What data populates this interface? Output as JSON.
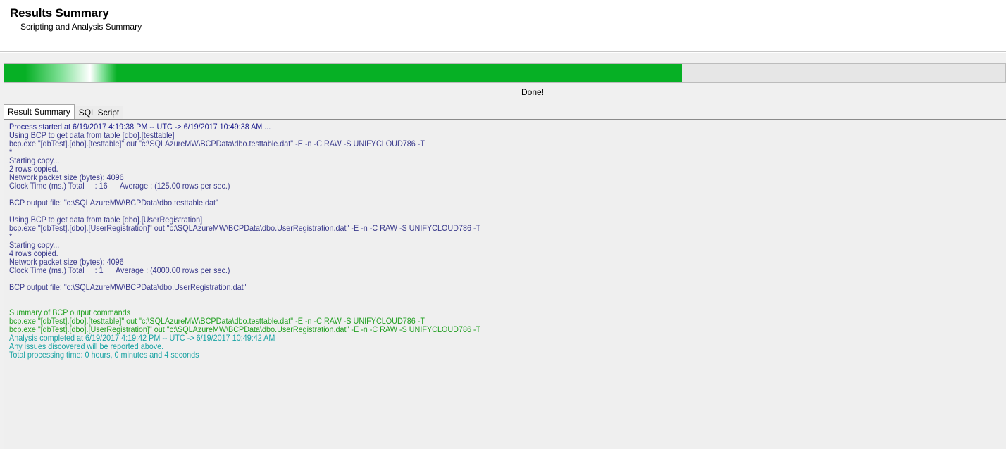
{
  "header": {
    "title": "Results Summary",
    "subtitle": "Scripting and Analysis Summary"
  },
  "progress": {
    "value_fraction": 0.677,
    "status": "Done!",
    "color": "#06b025"
  },
  "tabs": [
    {
      "label": "Result Summary",
      "active": true
    },
    {
      "label": "SQL Script",
      "active": false
    }
  ],
  "log": {
    "lines": [
      {
        "text": "Process started at 6/19/2017 4:19:38 PM -- UTC -> 6/19/2017 10:49:38 AM ...",
        "color": "navy"
      },
      {
        "text": "Using BCP to get data from table [dbo].[testtable]",
        "color": "blue"
      },
      {
        "text": "bcp.exe \"[dbTest].[dbo].[testtable]\" out \"c:\\SQLAzureMW\\BCPData\\dbo.testtable.dat\" -E -n -C RAW -S UNIFYCLOUD786 -T",
        "color": "blue"
      },
      {
        "text": "*",
        "color": "blue"
      },
      {
        "text": "Starting copy...",
        "color": "blue"
      },
      {
        "text": "2 rows copied.",
        "color": "blue"
      },
      {
        "text": "Network packet size (bytes): 4096",
        "color": "blue"
      },
      {
        "text": "Clock Time (ms.) Total     : 16      Average : (125.00 rows per sec.)",
        "color": "blue"
      },
      {
        "text": "",
        "color": "blue"
      },
      {
        "text": "BCP output file: \"c:\\SQLAzureMW\\BCPData\\dbo.testtable.dat\"",
        "color": "blue"
      },
      {
        "text": "",
        "color": "blue"
      },
      {
        "text": "Using BCP to get data from table [dbo].[UserRegistration]",
        "color": "blue"
      },
      {
        "text": "bcp.exe \"[dbTest].[dbo].[UserRegistration]\" out \"c:\\SQLAzureMW\\BCPData\\dbo.UserRegistration.dat\" -E -n -C RAW -S UNIFYCLOUD786 -T",
        "color": "blue"
      },
      {
        "text": "*",
        "color": "blue"
      },
      {
        "text": "Starting copy...",
        "color": "blue"
      },
      {
        "text": "4 rows copied.",
        "color": "blue"
      },
      {
        "text": "Network packet size (bytes): 4096",
        "color": "blue"
      },
      {
        "text": "Clock Time (ms.) Total     : 1      Average : (4000.00 rows per sec.)",
        "color": "blue"
      },
      {
        "text": "",
        "color": "blue"
      },
      {
        "text": "BCP output file: \"c:\\SQLAzureMW\\BCPData\\dbo.UserRegistration.dat\"",
        "color": "blue"
      },
      {
        "text": "",
        "color": "blue"
      },
      {
        "text": "",
        "color": "blue"
      },
      {
        "text": "Summary of BCP output commands",
        "color": "green"
      },
      {
        "text": "bcp.exe \"[dbTest].[dbo].[testtable]\" out \"c:\\SQLAzureMW\\BCPData\\dbo.testtable.dat\" -E -n -C RAW -S UNIFYCLOUD786 -T",
        "color": "green"
      },
      {
        "text": "bcp.exe \"[dbTest].[dbo].[UserRegistration]\" out \"c:\\SQLAzureMW\\BCPData\\dbo.UserRegistration.dat\" -E -n -C RAW -S UNIFYCLOUD786 -T",
        "color": "green"
      },
      {
        "text": "Analysis completed at 6/19/2017 4:19:42 PM -- UTC -> 6/19/2017 10:49:42 AM",
        "color": "teal"
      },
      {
        "text": "Any issues discovered will be reported above.",
        "color": "teal"
      },
      {
        "text": "Total processing time: 0 hours, 0 minutes and 4 seconds",
        "color": "teal"
      }
    ]
  }
}
